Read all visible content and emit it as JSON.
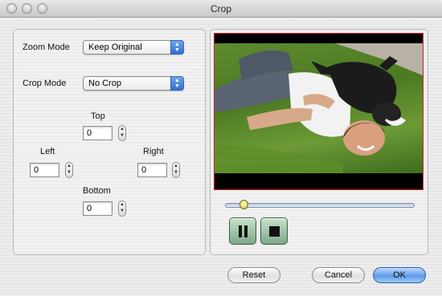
{
  "window": {
    "title": "Crop"
  },
  "zoom": {
    "label": "Zoom Mode",
    "value": "Keep Original"
  },
  "crop": {
    "label": "Crop Mode",
    "value": "No Crop"
  },
  "offsets": {
    "top_label": "Top",
    "top_value": "0",
    "left_label": "Left",
    "left_value": "0",
    "right_label": "Right",
    "right_value": "0",
    "bottom_label": "Bottom",
    "bottom_value": "0"
  },
  "player": {
    "position_fraction": 0.09
  },
  "buttons": {
    "reset": "Reset",
    "cancel": "Cancel",
    "ok": "OK"
  },
  "icons": {
    "close": "close-icon",
    "minimize": "minimize-icon",
    "zoom": "zoom-icon",
    "pause": "pause-icon",
    "stop": "stop-icon",
    "dropdown": "chevron-updown-icon",
    "stepper": "stepper-arrows-icon"
  },
  "colors": {
    "accent": "#4a8de6",
    "preview_border": "#d02020"
  }
}
